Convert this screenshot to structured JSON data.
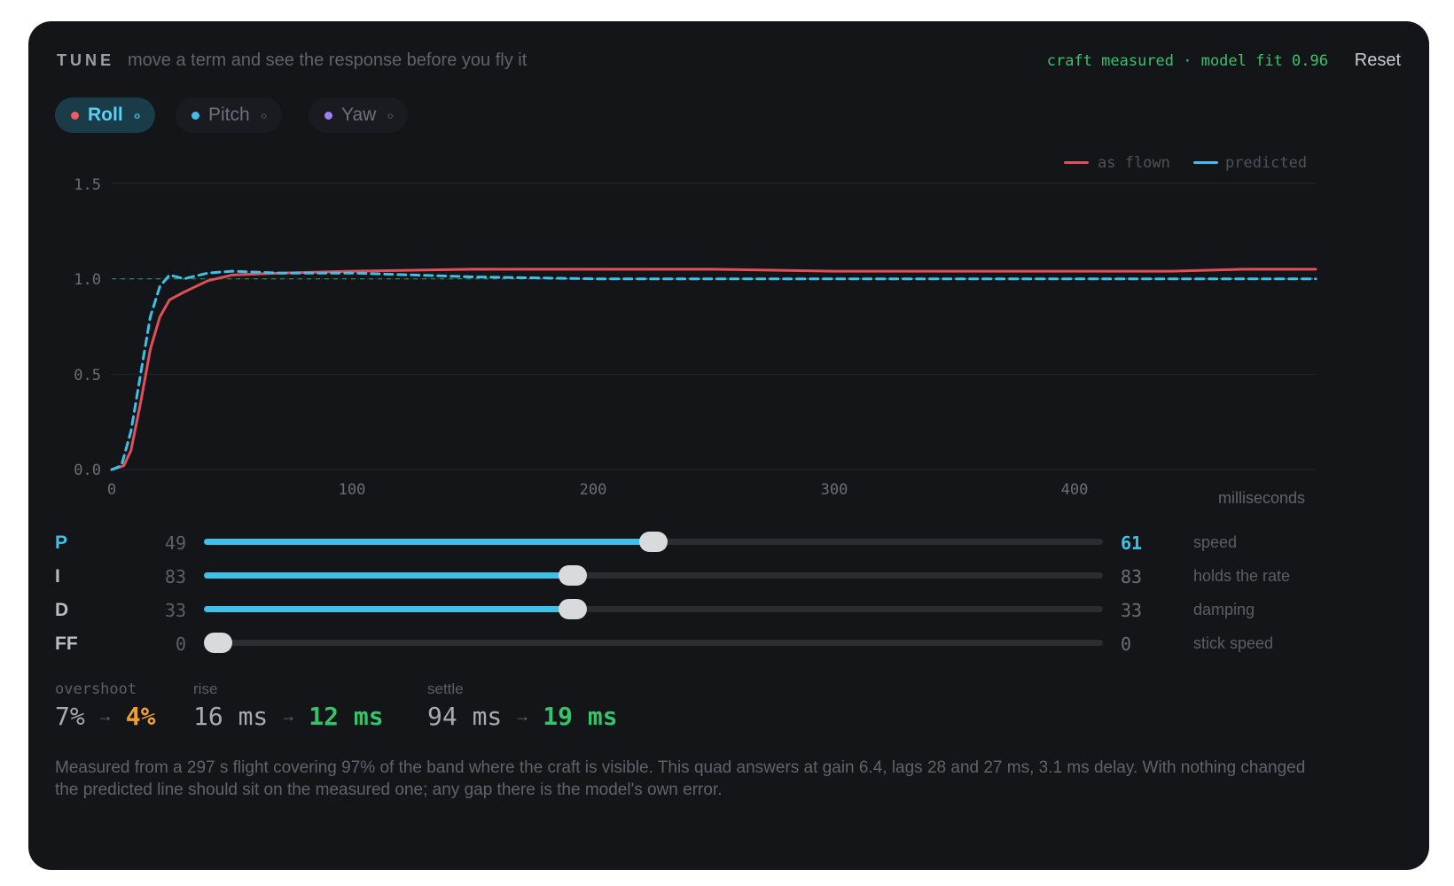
{
  "header": {
    "title": "TUNE",
    "subtitle": "move a term and see the response before you fly it",
    "status": "craft measured · model fit 0.96",
    "reset_label": "Reset"
  },
  "tabs": [
    {
      "label": "Roll",
      "dot_color": "#f05a64",
      "active": true
    },
    {
      "label": "Pitch",
      "dot_color": "#3ec0e8",
      "active": false
    },
    {
      "label": "Yaw",
      "dot_color": "#a27cf2",
      "active": false
    }
  ],
  "icons": {
    "grip": "grip-icon",
    "arrow": "arrow-right-icon"
  },
  "chart_data": {
    "type": "line",
    "xlabel": "milliseconds",
    "ylabel": "",
    "xlim": [
      0,
      500
    ],
    "ylim": [
      0,
      1.5
    ],
    "x_ticks": [
      "0",
      "100",
      "200",
      "300",
      "400"
    ],
    "y_ticks": [
      "1.5",
      "1.0",
      "0.5",
      "0.0"
    ],
    "reference_line": {
      "y": 1.0,
      "style": "dashed",
      "color": "#2f7a4a"
    },
    "grid": true,
    "legend_position": "top-right",
    "series": [
      {
        "name": "as flown",
        "color": "#e0505a",
        "style": "solid",
        "points": [
          [
            0,
            0
          ],
          [
            5,
            0.02
          ],
          [
            8,
            0.1
          ],
          [
            12,
            0.35
          ],
          [
            16,
            0.63
          ],
          [
            20,
            0.8
          ],
          [
            24,
            0.89
          ],
          [
            30,
            0.93
          ],
          [
            40,
            0.99
          ],
          [
            50,
            1.02
          ],
          [
            70,
            1.03
          ],
          [
            100,
            1.04
          ],
          [
            150,
            1.05
          ],
          [
            200,
            1.05
          ],
          [
            250,
            1.05
          ],
          [
            300,
            1.04
          ],
          [
            350,
            1.04
          ],
          [
            400,
            1.04
          ],
          [
            440,
            1.04
          ],
          [
            470,
            1.05
          ],
          [
            500,
            1.05
          ]
        ]
      },
      {
        "name": "predicted",
        "color": "#3ec0e8",
        "style": "dashed",
        "points": [
          [
            0,
            0
          ],
          [
            4,
            0.02
          ],
          [
            8,
            0.2
          ],
          [
            12,
            0.5
          ],
          [
            16,
            0.8
          ],
          [
            20,
            0.96
          ],
          [
            24,
            1.02
          ],
          [
            30,
            1.0
          ],
          [
            40,
            1.03
          ],
          [
            50,
            1.04
          ],
          [
            70,
            1.03
          ],
          [
            100,
            1.03
          ],
          [
            150,
            1.01
          ],
          [
            200,
            1.0
          ],
          [
            250,
            1.0
          ],
          [
            300,
            1.0
          ],
          [
            350,
            1.0
          ],
          [
            400,
            1.0
          ],
          [
            450,
            1.0
          ],
          [
            500,
            1.0
          ]
        ]
      }
    ]
  },
  "sliders": [
    {
      "name": "P",
      "old": "49",
      "new": "61",
      "desc": "speed",
      "fraction": 0.5,
      "name_color": "#3ec0e8",
      "new_color": "#3ec0e8",
      "has_fill": true
    },
    {
      "name": "I",
      "old": "83",
      "new": "83",
      "desc": "holds the rate",
      "fraction": 0.41,
      "name_color": "#b9bdc3",
      "new_color": "#6a6e76",
      "has_fill": true
    },
    {
      "name": "D",
      "old": "33",
      "new": "33",
      "desc": "damping",
      "fraction": 0.41,
      "name_color": "#b9bdc3",
      "new_color": "#6a6e76",
      "has_fill": true
    },
    {
      "name": "FF",
      "old": "0",
      "new": "0",
      "desc": "stick speed",
      "fraction": 0.0,
      "name_color": "#b9bdc3",
      "new_color": "#6a6e76",
      "has_fill": false
    }
  ],
  "metrics": [
    {
      "label": "overshoot",
      "before": "7%",
      "after": "4%",
      "after_color": "#f0a030"
    },
    {
      "label": "rise",
      "before": "16 ms",
      "after": "12 ms",
      "after_color": "#35c46a"
    },
    {
      "label": "settle",
      "before": "94 ms",
      "after": "19 ms",
      "after_color": "#35c46a"
    }
  ],
  "note": "Measured from a 297 s flight covering 97% of the band where the craft is visible. This quad answers at gain 6.4, lags 28 and 27 ms, 3.1 ms delay. With nothing changed the predicted line should sit on the measured one; any gap there is the model's own error."
}
